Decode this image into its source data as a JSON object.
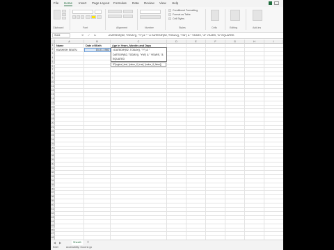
{
  "ribbon": {
    "tabs": [
      "File",
      "Home",
      "Insert",
      "Page Layout",
      "Formulas",
      "Data",
      "Review",
      "View",
      "Help"
    ],
    "active_tab": "Home",
    "groups": [
      "Clipboard",
      "Font",
      "Alignment",
      "Number",
      "Styles",
      "Cells",
      "Editing",
      "Add-ins"
    ],
    "styles_items": [
      "Conditional Formatting",
      "Format as Table",
      "Cell Styles"
    ]
  },
  "formula_bar": {
    "name_box": "SUM",
    "cancel": "✕",
    "enter": "✓",
    "fx": "fx",
    "formula": "=DATEDIF(B2, TODAY(), \"Y\") & \" \" & DATEDIF(B2, TODAY(), \"YM\") & \" YEARS, \"&\"  YEARS, \"&\" EQUATED"
  },
  "grid": {
    "columns": [
      "A",
      "B",
      "C",
      "D",
      "E",
      "F",
      "G",
      "H",
      "I"
    ],
    "rows": [
      "1",
      "2",
      "3",
      "4",
      "5",
      "6",
      "7",
      "8",
      "9",
      "10",
      "11",
      "12",
      "13",
      "14",
      "15",
      "16",
      "17",
      "18",
      "19",
      "20",
      "21",
      "22",
      "23",
      "24",
      "25",
      "26",
      "27",
      "28",
      "29",
      "30",
      "31",
      "32",
      "33",
      "34",
      "35",
      "36",
      "37",
      "38",
      "39",
      "40",
      "41",
      "42",
      "43",
      "44",
      "45",
      "46",
      "47",
      "48"
    ],
    "headers": {
      "name": "Name",
      "dob": "Date of Birth",
      "age": "Age in Years, Months and Days"
    },
    "row2": {
      "name": "KASHISH SEATU",
      "dob": "15-01-1982"
    },
    "editing": {
      "line1": "=DATEDIF(B2, TODAY(), \"Y\") & \"",
      "line2": "DATEDIF(B2, TODAY(), \"YM\") & \" YEARS, \"&",
      "line3": "EQUATED"
    },
    "tooltip": "IF(logical_test, [value_if_true], [value_if_false])"
  },
  "sheets": {
    "tabs": [
      "Sheet1"
    ],
    "add": "+"
  },
  "status": {
    "mode": "Enter",
    "accessibility": "Accessibility: Good to go"
  }
}
